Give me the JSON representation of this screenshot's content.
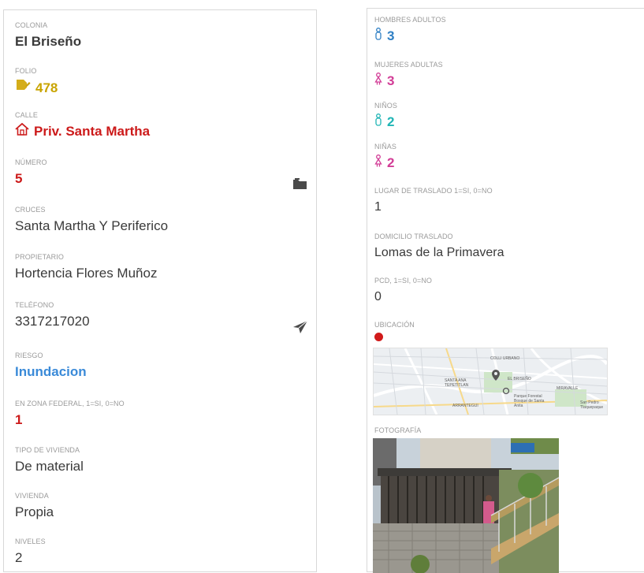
{
  "left_card": {
    "fields": [
      {
        "label": "COLONIA",
        "value": "El Briseño"
      },
      {
        "label": "FOLIO",
        "value": "478"
      },
      {
        "label": "CALLE",
        "value": "Priv. Santa Martha"
      },
      {
        "label": "NÚMERO",
        "value": "5"
      },
      {
        "label": "CRUCES",
        "value": "Santa Martha Y Periferico"
      },
      {
        "label": "PROPIETARIO",
        "value": "Hortencia Flores Muñoz"
      },
      {
        "label": "TELÉFONO",
        "value": "3317217020"
      },
      {
        "label": "RIESGO",
        "value": "Inundacion"
      },
      {
        "label": "EN ZONA FEDERAL, 1=SI, 0=NO",
        "value": "1"
      },
      {
        "label": "TIPO DE VIVIENDA",
        "value": "De material"
      },
      {
        "label": "VIVIENDA",
        "value": "Propia"
      },
      {
        "label": "NIVELES",
        "value": "2"
      }
    ],
    "icons": {
      "folio": "edit-document-icon",
      "calle": "house-icon",
      "numero": "folder-icon",
      "telefono": "send-icon"
    }
  },
  "right_card": {
    "fields": [
      {
        "label": "HOMBRES ADULTOS",
        "value": "3"
      },
      {
        "label": "MUJERES ADULTAS",
        "value": "3"
      },
      {
        "label": "NIÑOS",
        "value": "2"
      },
      {
        "label": "NIÑAS",
        "value": "2"
      },
      {
        "label": "LUGAR DE TRASLADO 1=SI, 0=NO",
        "value": "1"
      },
      {
        "label": "DOMICILIO TRASLADO",
        "value": "Lomas de la Primavera"
      },
      {
        "label": "PCD, 1=SI, 0=NO",
        "value": "0"
      },
      {
        "label": "UBICACIÓN",
        "value": ""
      },
      {
        "label": "FOTOGRAFÍA",
        "value": ""
      }
    ],
    "map_labels": [
      "COLLI URBANO",
      "SANTA ANA TEPETITLAN",
      "EL BRISEÑO",
      "MIRAVALLE",
      "San Pedro Tlaquepaque",
      "Parque Forestal Bosque de Santa Anita",
      "ARRANTEGUI"
    ],
    "icons": {
      "hombres": "male-icon",
      "mujeres": "female-icon",
      "ninos": "male-icon",
      "ninas": "female-icon",
      "ubicacion": "red-dot-icon",
      "map": "map-thumbnail",
      "photo": "house-photo"
    }
  },
  "colors": {
    "folio": "#c9a400",
    "calle": "#cc1a1a",
    "numero": "#cc1a1a",
    "riesgo": "#3a8ad8",
    "zona_federal": "#cc1a1a",
    "hombres": "#2f7fc4",
    "mujeres": "#d23c96",
    "ninos": "#20b5b5",
    "ninas": "#d23c96",
    "ubicacion_dot": "#d11a1a"
  }
}
